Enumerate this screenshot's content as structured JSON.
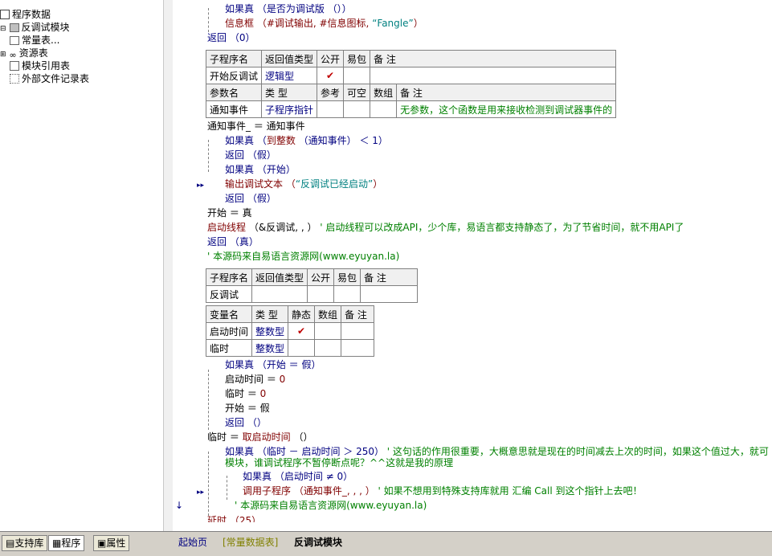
{
  "tree": {
    "items": [
      {
        "label": "程序数据"
      },
      {
        "label": "反调试模块"
      },
      {
        "label": "常量表..."
      },
      {
        "label": "资源表"
      },
      {
        "label": "模块引用表"
      },
      {
        "label": "外部文件记录表"
      }
    ]
  },
  "bottom_tabs": {
    "support": "支持库",
    "program": "程序",
    "property": "属性"
  },
  "editor_tabs": {
    "start": "起始页",
    "const": "[常量数据表]",
    "module": "反调试模块"
  },
  "code": {
    "l1": "如果真 （是否为调试版 （））",
    "l2a": "信息框 （#调试输出, #信息图标, ",
    "l2b": "“Fangle”",
    "l2c": "）",
    "l3": "返回 （0）",
    "l4": "通知事件_ ＝ 通知事件",
    "l5a": "如果真 （",
    "l5b": "到整数",
    "l5c": " （通知事件） ＜ 1）",
    "l6": "返回 （假）",
    "l7": "如果真 （开始）",
    "l8a": "输出调试文本 （",
    "l8b": "“反调试已经启动”",
    "l8c": "）",
    "l9": "返回 （假）",
    "l10": "开始 ＝ 真",
    "l11a": "启动线程",
    "l11b": " （&反调试, , ） ",
    "l11c": "' 启动线程可以改成API，少个库，易语言都支持静态了，为了节省时间，就不用API了",
    "l12": "返回 （真）",
    "l13": "' 本源码来自易语言资源网(www.eyuyan.la)",
    "l14": "如果真 （开始 ＝ 假）",
    "l15a": "启动时间 ＝ ",
    "l15b": "0",
    "l16a": "临时 ＝ ",
    "l16b": "0",
    "l17": "开始 ＝ 假",
    "l18": "返回 （）",
    "l19a": "临时 ＝ ",
    "l19b": "取启动时间",
    "l19c": " （）",
    "l20a": "如果真 （临时 － 启动时间 ＞ 250） ",
    "l20b": "' 这句话的作用很重要，大概意思就是现在的时间减去上次的时间，如果这个值过大，就可",
    "l21": "模块，谁调试程序不暂停断点呢？^^这就是我的原理",
    "l22": "如果真 （启动时间 ≠ 0）",
    "l23a": "调用子程序 （通知事件_, , , ） ",
    "l23b": "' 如果不想用到特殊支持库就用 汇编 Call 到这个指针上去吧！",
    "l24": "' 本源码来自易语言资源网(www.eyuyan.la)",
    "l25": "延时 （25）"
  },
  "table1": {
    "h": [
      "子程序名",
      "返回值类型",
      "公开",
      "易包",
      "备 注"
    ],
    "r": [
      "开始反调试",
      "逻辑型",
      "✔",
      "",
      ""
    ],
    "h2": [
      "参数名",
      "类 型",
      "参考",
      "可空",
      "数组",
      "备 注"
    ],
    "r2": [
      "通知事件",
      "子程序指针",
      "",
      "",
      "",
      "无参数，这个函数是用来接收检测到调试器事件的"
    ]
  },
  "table2": {
    "h": [
      "子程序名",
      "返回值类型",
      "公开",
      "易包",
      "备 注"
    ],
    "r": [
      "反调试",
      "",
      "",
      "",
      ""
    ]
  },
  "table3": {
    "h": [
      "变量名",
      "类 型",
      "静态",
      "数组",
      "备 注"
    ],
    "r1": [
      "启动时间",
      "整数型",
      "✔",
      "",
      ""
    ],
    "r2": [
      "临时",
      "整数型",
      "",
      "",
      ""
    ]
  }
}
